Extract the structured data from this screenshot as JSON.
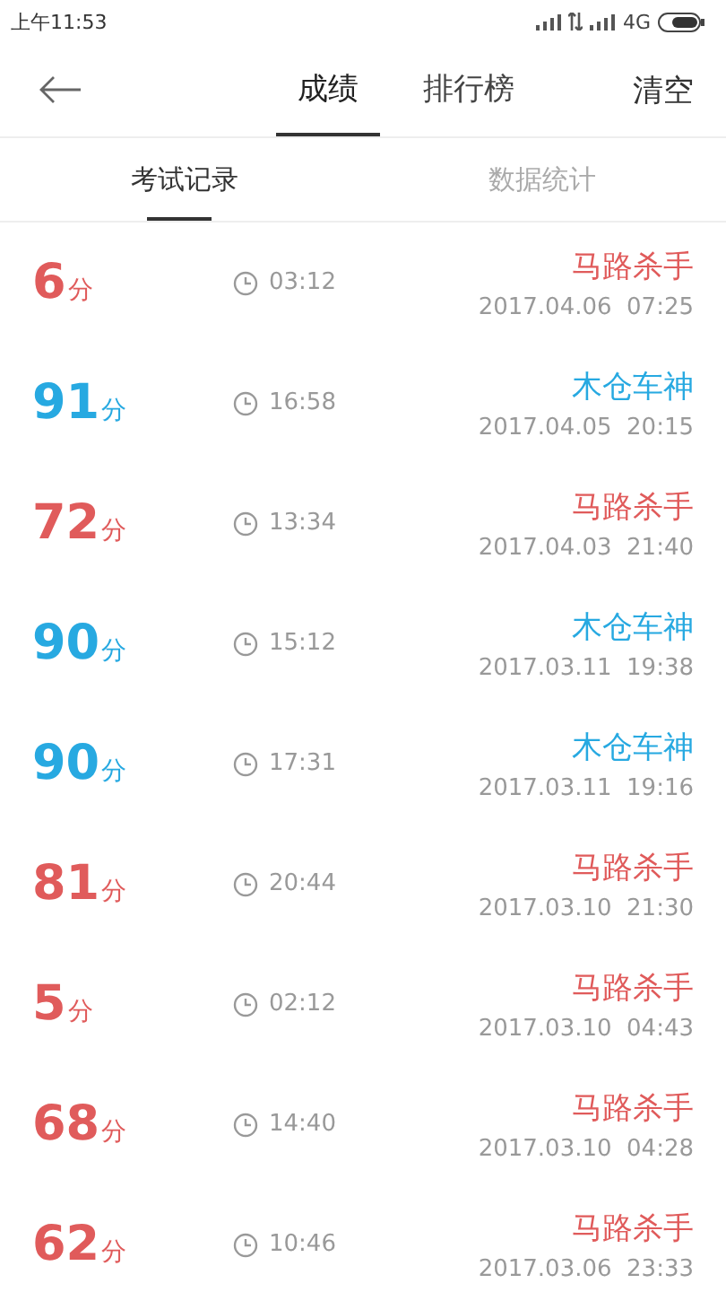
{
  "status_bar": {
    "time": "上午11:53",
    "network": "4G"
  },
  "nav": {
    "tabs": [
      {
        "label": "成绩",
        "selected": true
      },
      {
        "label": "排行榜",
        "selected": false
      }
    ],
    "action": "清空"
  },
  "sub_tabs": [
    {
      "label": "考试记录",
      "selected": true
    },
    {
      "label": "数据统计",
      "selected": false
    }
  ],
  "records": [
    {
      "score": "6",
      "unit": "分",
      "duration": "03:12",
      "title": "马路杀手",
      "date": "2017.04.06  07:25",
      "color": "#e05b5b"
    },
    {
      "score": "91",
      "unit": "分",
      "duration": "16:58",
      "title": "木仓车神",
      "date": "2017.04.05  20:15",
      "color": "#27a9e1"
    },
    {
      "score": "72",
      "unit": "分",
      "duration": "13:34",
      "title": "马路杀手",
      "date": "2017.04.03  21:40",
      "color": "#e05b5b"
    },
    {
      "score": "90",
      "unit": "分",
      "duration": "15:12",
      "title": "木仓车神",
      "date": "2017.03.11  19:38",
      "color": "#27a9e1"
    },
    {
      "score": "90",
      "unit": "分",
      "duration": "17:31",
      "title": "木仓车神",
      "date": "2017.03.11  19:16",
      "color": "#27a9e1"
    },
    {
      "score": "81",
      "unit": "分",
      "duration": "20:44",
      "title": "马路杀手",
      "date": "2017.03.10  21:30",
      "color": "#e05b5b"
    },
    {
      "score": "5",
      "unit": "分",
      "duration": "02:12",
      "title": "马路杀手",
      "date": "2017.03.10  04:43",
      "color": "#e05b5b"
    },
    {
      "score": "68",
      "unit": "分",
      "duration": "14:40",
      "title": "马路杀手",
      "date": "2017.03.10  04:28",
      "color": "#e05b5b"
    },
    {
      "score": "62",
      "unit": "分",
      "duration": "10:46",
      "title": "马路杀手",
      "date": "2017.03.06  23:33",
      "color": "#e05b5b"
    }
  ]
}
